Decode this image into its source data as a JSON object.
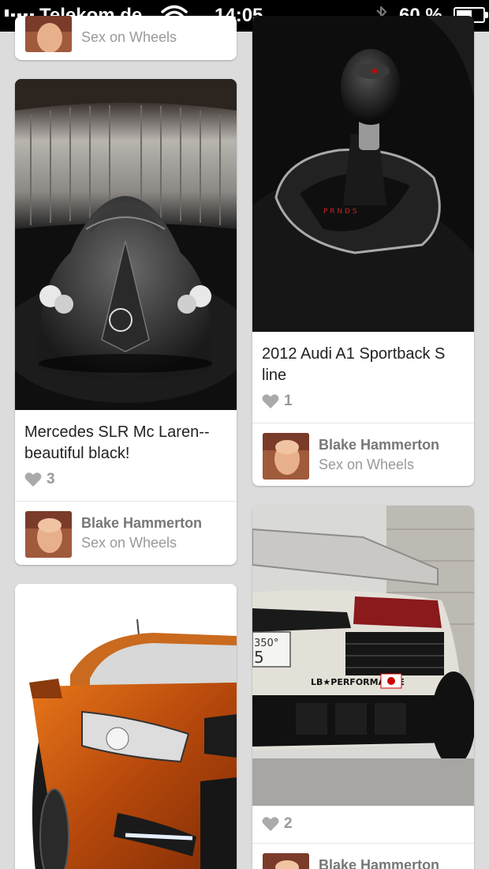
{
  "status_bar": {
    "carrier": "Telekom.de",
    "time": "14:05",
    "battery_percent": "60 %",
    "battery_level": 0.6
  },
  "pins": [
    {
      "pinner": {
        "board": "Sex on Wheels"
      }
    },
    {
      "description": "Mercedes SLR Mc Laren--beautiful black!",
      "likes": "3",
      "pinner": {
        "name": "Blake Hammerton",
        "board": "Sex on Wheels"
      }
    },
    {
      "description": "2012 Audi A1 Sportback S line",
      "likes": "1",
      "pinner": {
        "name": "Blake Hammerton",
        "board": "Sex on Wheels"
      }
    },
    {
      "image_text": [
        "LB★PERFORMANCE",
        "350°",
        "5"
      ],
      "likes": "2",
      "pinner": {
        "name": "Blake Hammerton"
      }
    },
    {}
  ],
  "icons": {
    "like": "heart-icon",
    "wifi": "wifi-icon",
    "bluetooth": "bluetooth-icon",
    "battery": "battery-icon"
  },
  "colors": {
    "background": "#dcdcdc",
    "card": "#ffffff",
    "meta_text": "#999999"
  }
}
